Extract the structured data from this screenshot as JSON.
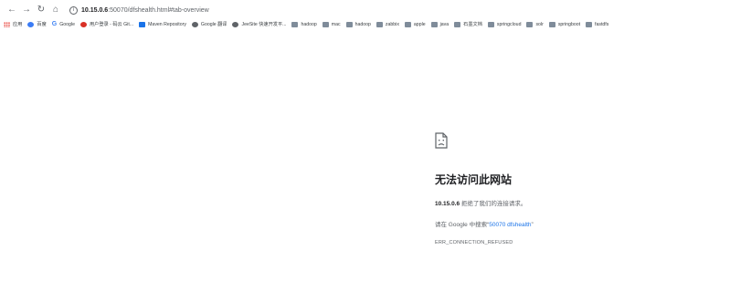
{
  "toolbar": {
    "back_icon": "back-arrow-icon",
    "forward_icon": "forward-arrow-icon",
    "reload_icon": "reload-icon",
    "home_icon": "home-icon",
    "url_host": "10.15.0.6",
    "url_rest": ":50070/dfshealth.html#tab-overview"
  },
  "bookmarks": [
    {
      "icon": "apps-grid-icon",
      "label": "应用"
    },
    {
      "icon": "baidu-icon",
      "label": "百度"
    },
    {
      "icon": "google-icon",
      "label": "Google"
    },
    {
      "icon": "user-login-icon",
      "label": "用户登录 - 码云 Git..."
    },
    {
      "icon": "maven-icon",
      "label": "Maven Repository"
    },
    {
      "icon": "globe-icon",
      "label": "Google 翻译"
    },
    {
      "icon": "globe-icon",
      "label": "JeeSite 快速开发平..."
    },
    {
      "icon": "folder-icon",
      "label": "hadoop"
    },
    {
      "icon": "folder-icon",
      "label": "mac"
    },
    {
      "icon": "folder-icon",
      "label": "hadoop"
    },
    {
      "icon": "folder-icon",
      "label": "zabbix"
    },
    {
      "icon": "folder-icon",
      "label": "apple"
    },
    {
      "icon": "folder-icon",
      "label": "java"
    },
    {
      "icon": "folder-icon",
      "label": "石墨文档"
    },
    {
      "icon": "folder-icon",
      "label": "springcloud"
    },
    {
      "icon": "folder-icon",
      "label": "solr"
    },
    {
      "icon": "folder-icon",
      "label": "springboot"
    },
    {
      "icon": "folder-icon",
      "label": "fastdfs"
    }
  ],
  "error": {
    "title": "无法访问此网站",
    "host": "10.15.0.6",
    "refused_text": " 拒绝了我们的连接请求。",
    "search_prefix": "请在 Google 中搜索“",
    "search_link": "50070 dfshealth",
    "search_suffix": "”",
    "code": "ERR_CONNECTION_REFUSED"
  }
}
